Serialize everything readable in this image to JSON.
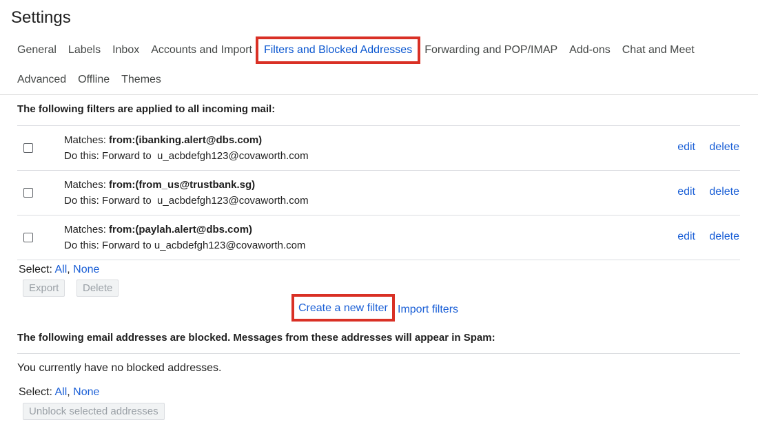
{
  "page": {
    "title": "Settings"
  },
  "tabs": {
    "row1": [
      {
        "id": "general",
        "label": "General"
      },
      {
        "id": "labels",
        "label": "Labels"
      },
      {
        "id": "inbox",
        "label": "Inbox"
      },
      {
        "id": "accounts",
        "label": "Accounts and Import"
      },
      {
        "id": "filters",
        "label": "Filters and Blocked Addresses",
        "active": true
      },
      {
        "id": "forwarding",
        "label": "Forwarding and POP/IMAP"
      },
      {
        "id": "addons",
        "label": "Add-ons"
      },
      {
        "id": "chat",
        "label": "Chat and Meet"
      }
    ],
    "row2": [
      {
        "id": "advanced",
        "label": "Advanced"
      },
      {
        "id": "offline",
        "label": "Offline"
      },
      {
        "id": "themes",
        "label": "Themes"
      }
    ]
  },
  "filters": {
    "heading": "The following filters are applied to all incoming mail:",
    "matches_label": "Matches:",
    "dothis_label": "Do this:",
    "edit_label": "edit",
    "delete_label": "delete",
    "items": [
      {
        "criteria": "from:(ibanking.alert@dbs.com)",
        "action": "Forward to  u_acbdefgh123@covaworth.com"
      },
      {
        "criteria": "from:(from_us@trustbank.sg)",
        "action": "Forward to  u_acbdefgh123@covaworth.com"
      },
      {
        "criteria": "from:(paylah.alert@dbs.com)",
        "action": "Forward to u_acbdefgh123@covaworth.com"
      }
    ],
    "select_label": "Select:",
    "select_all": "All",
    "select_sep": ",",
    "select_none": "None",
    "export_label": "Export",
    "delete_button_label": "Delete",
    "create_label": "Create a new filter",
    "import_label": "Import filters"
  },
  "blocked": {
    "heading": "The following email addresses are blocked. Messages from these addresses will appear in Spam:",
    "empty_text": "You currently have no blocked addresses.",
    "select_label": "Select:",
    "select_all": "All",
    "select_sep": ",",
    "select_none": "None",
    "unblock_label": "Unblock selected addresses"
  },
  "colors": {
    "accent_link": "#1a5fd6",
    "active_tab": "#0b57d0",
    "highlight_box": "#d93025"
  }
}
